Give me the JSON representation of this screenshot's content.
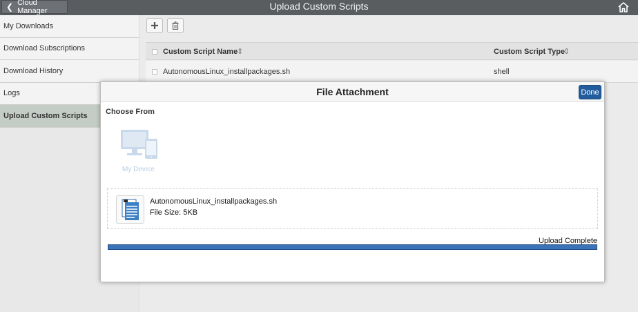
{
  "header": {
    "back_label": "Cloud Manager",
    "title": "Upload Custom Scripts"
  },
  "sidebar": {
    "items": [
      {
        "label": "My Downloads"
      },
      {
        "label": "Download Subscriptions"
      },
      {
        "label": "Download History"
      },
      {
        "label": "Logs"
      },
      {
        "label": "Upload Custom Scripts"
      }
    ]
  },
  "grid": {
    "columns": [
      "Custom Script Name",
      "Custom Script Type"
    ],
    "rows": [
      {
        "name": "AutonomousLinux_installpackages.sh",
        "type": "shell"
      }
    ]
  },
  "modal": {
    "title": "File Attachment",
    "done_label": "Done",
    "choose_from": "Choose From",
    "device_label": "My Device",
    "file": {
      "name": "AutonomousLinux_installpackages.sh",
      "size_text": "File Size: 5KB"
    },
    "upload_status": "Upload Complete",
    "progress_fraction": 1.0
  },
  "icons": {
    "back": "chevron-left-icon",
    "home": "home-icon",
    "add": "plus-icon",
    "delete": "trash-icon",
    "sort": "sort-icon",
    "device": "desktop-tablet-icon",
    "file": "document-icon"
  },
  "colors": {
    "accent": "#225c9c",
    "progress": "#3a73b8",
    "topbar": "#5a5d60",
    "sidebar_active": "#c3cdc6"
  }
}
